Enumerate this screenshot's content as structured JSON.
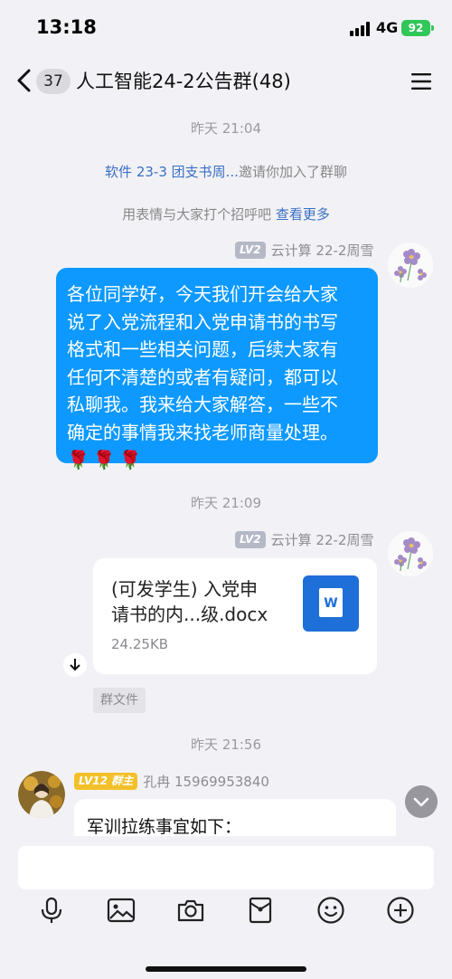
{
  "status_bar": {
    "time": "13:18",
    "network": "4G",
    "battery": "92"
  },
  "header": {
    "unread_count": "37",
    "title": "人工智能24-2公告群(48)"
  },
  "messages": {
    "ts1": "昨天 21:04",
    "invite": {
      "inviter": "软件 23-3 团支书周...",
      "text": "邀请你加入了群聊"
    },
    "greet": {
      "text": "用表情与大家打个招呼吧",
      "link": "查看更多"
    },
    "msg1": {
      "level": "LV2",
      "sender": "云计算 22-2周雪",
      "lines": [
        "各位同学好，今天我们开会给大家",
        "说了入党流程和入党申请书的书写",
        "格式和一些相关问题，后续大家有",
        "任何不清楚的或者有疑问，都可以",
        "私聊我。我来给大家解答，一些不",
        "确定的事情我来找老师商量处理。"
      ],
      "emoji": "🌹🌹🌹"
    },
    "ts2": "昨天 21:09",
    "msg2": {
      "level": "LV2",
      "sender": "云计算 22-2周雪",
      "file_name_1": "(可发学生) 入党申",
      "file_name_2": "请书的内...级.docx",
      "file_size": "24.25KB",
      "file_type_letter": "W",
      "tag": "群文件"
    },
    "ts3": "昨天 21:56",
    "msg3": {
      "level": "LV12",
      "role": "群主",
      "sender": "孔冉 15969953840",
      "text": "军训拉练事宜如下："
    }
  },
  "colors": {
    "bubble_blue": "#0d99ff",
    "link": "#3a6fc4",
    "battery": "#31c759",
    "level_gold": "#f4c02a"
  },
  "icons": [
    "back-arrow-icon",
    "menu-icon",
    "download-icon",
    "chevron-down-icon",
    "microphone-icon",
    "image-icon",
    "camera-icon",
    "red-packet-icon",
    "emoji-icon",
    "plus-icon",
    "word-file-icon"
  ]
}
